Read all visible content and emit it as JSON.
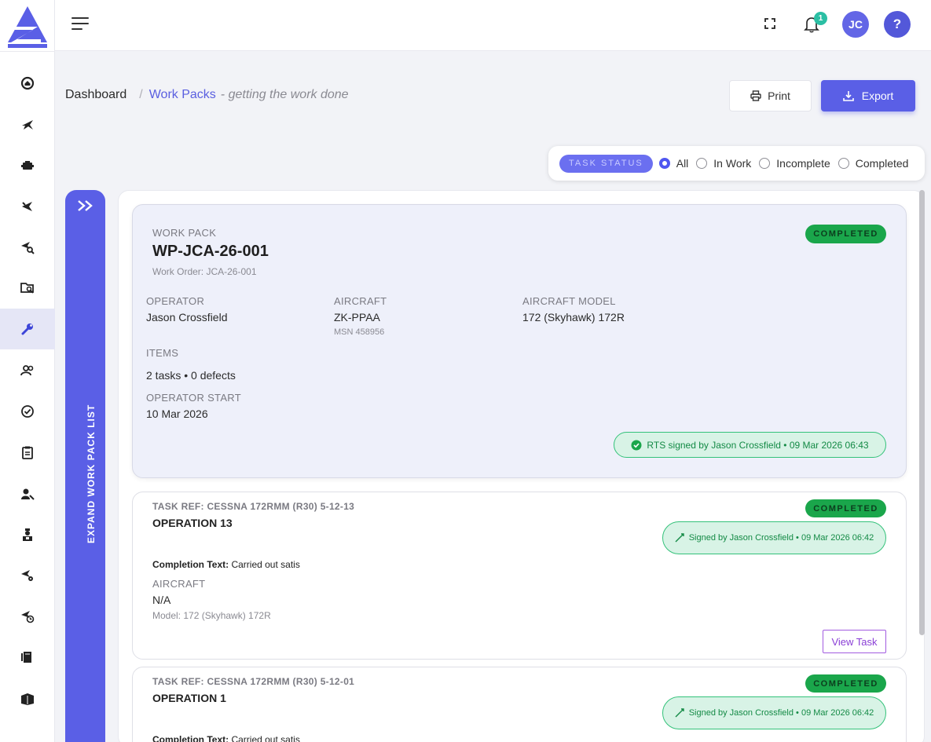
{
  "topbar": {
    "notifications_count": "1",
    "avatar_initials": "JC",
    "help_label": "?"
  },
  "breadcrumb": {
    "home": "Dashboard",
    "separator": "/",
    "current": "Work Packs",
    "subtitle": "- getting the work done"
  },
  "actions": {
    "print_label": "Print",
    "export_label": "Export"
  },
  "filter": {
    "tag": "TASK STATUS",
    "options": [
      {
        "label": "All",
        "checked": true
      },
      {
        "label": "In Work",
        "checked": false
      },
      {
        "label": "Incomplete",
        "checked": false
      },
      {
        "label": "Completed",
        "checked": false
      }
    ]
  },
  "expand_tab": {
    "label": "EXPAND WORK PACK LIST",
    "arrow": ">>"
  },
  "work_pack": {
    "section_label": "WORK PACK",
    "id": "WP-JCA-26-001",
    "work_order": "Work Order: JCA-26-001",
    "status": "COMPLETED",
    "operator_label": "OPERATOR",
    "operator": "Jason Crossfield",
    "aircraft_label": "AIRCRAFT",
    "aircraft": "ZK-PPAA",
    "msn": "MSN 458956",
    "aircraft_model_label": "AIRCRAFT MODEL",
    "aircraft_model": "172 (Skyhawk) 172R",
    "items_label": "ITEMS",
    "items": "2 tasks • 0 defects",
    "operator_start_label": "OPERATOR START",
    "operator_start": "10 Mar 2026",
    "rts": "RTS signed by Jason Crossfield • 09 Mar 2026 06:43"
  },
  "tasks": [
    {
      "ref": "TASK REF: CESSNA 172RMM (R30) 5-12-13",
      "title": "OPERATION 13",
      "status": "COMPLETED",
      "signed": "Signed by Jason Crossfield • 09 Mar 2026 06:42",
      "completion_label": "Completion Text:",
      "completion_text": "Carried out satis",
      "aircraft_label": "AIRCRAFT",
      "aircraft": "N/A",
      "model": "Model: 172 (Skyhawk) 172R",
      "view_label": "View Task"
    },
    {
      "ref": "TASK REF: CESSNA 172RMM (R30) 5-12-01",
      "title": "OPERATION 1",
      "status": "COMPLETED",
      "signed": "Signed by Jason Crossfield • 09 Mar 2026 06:42",
      "completion_label": "Completion Text:",
      "completion_text": "Carried out satis"
    }
  ],
  "colors": {
    "accent": "#5a5fe6",
    "success": "#1aa64b",
    "active_nav": "#e5e6f6"
  },
  "sidebar_icons": [
    "home-icon",
    "plane-icon",
    "engine-icon",
    "plane-check-icon",
    "plane-search-icon",
    "folder-search-icon",
    "wrench-icon",
    "users-icon",
    "check-circle-icon",
    "clipboard-icon",
    "user-key-icon",
    "engineer-icon",
    "plane-location-icon",
    "plane-clock-icon",
    "manual-icon",
    "book-icon"
  ]
}
